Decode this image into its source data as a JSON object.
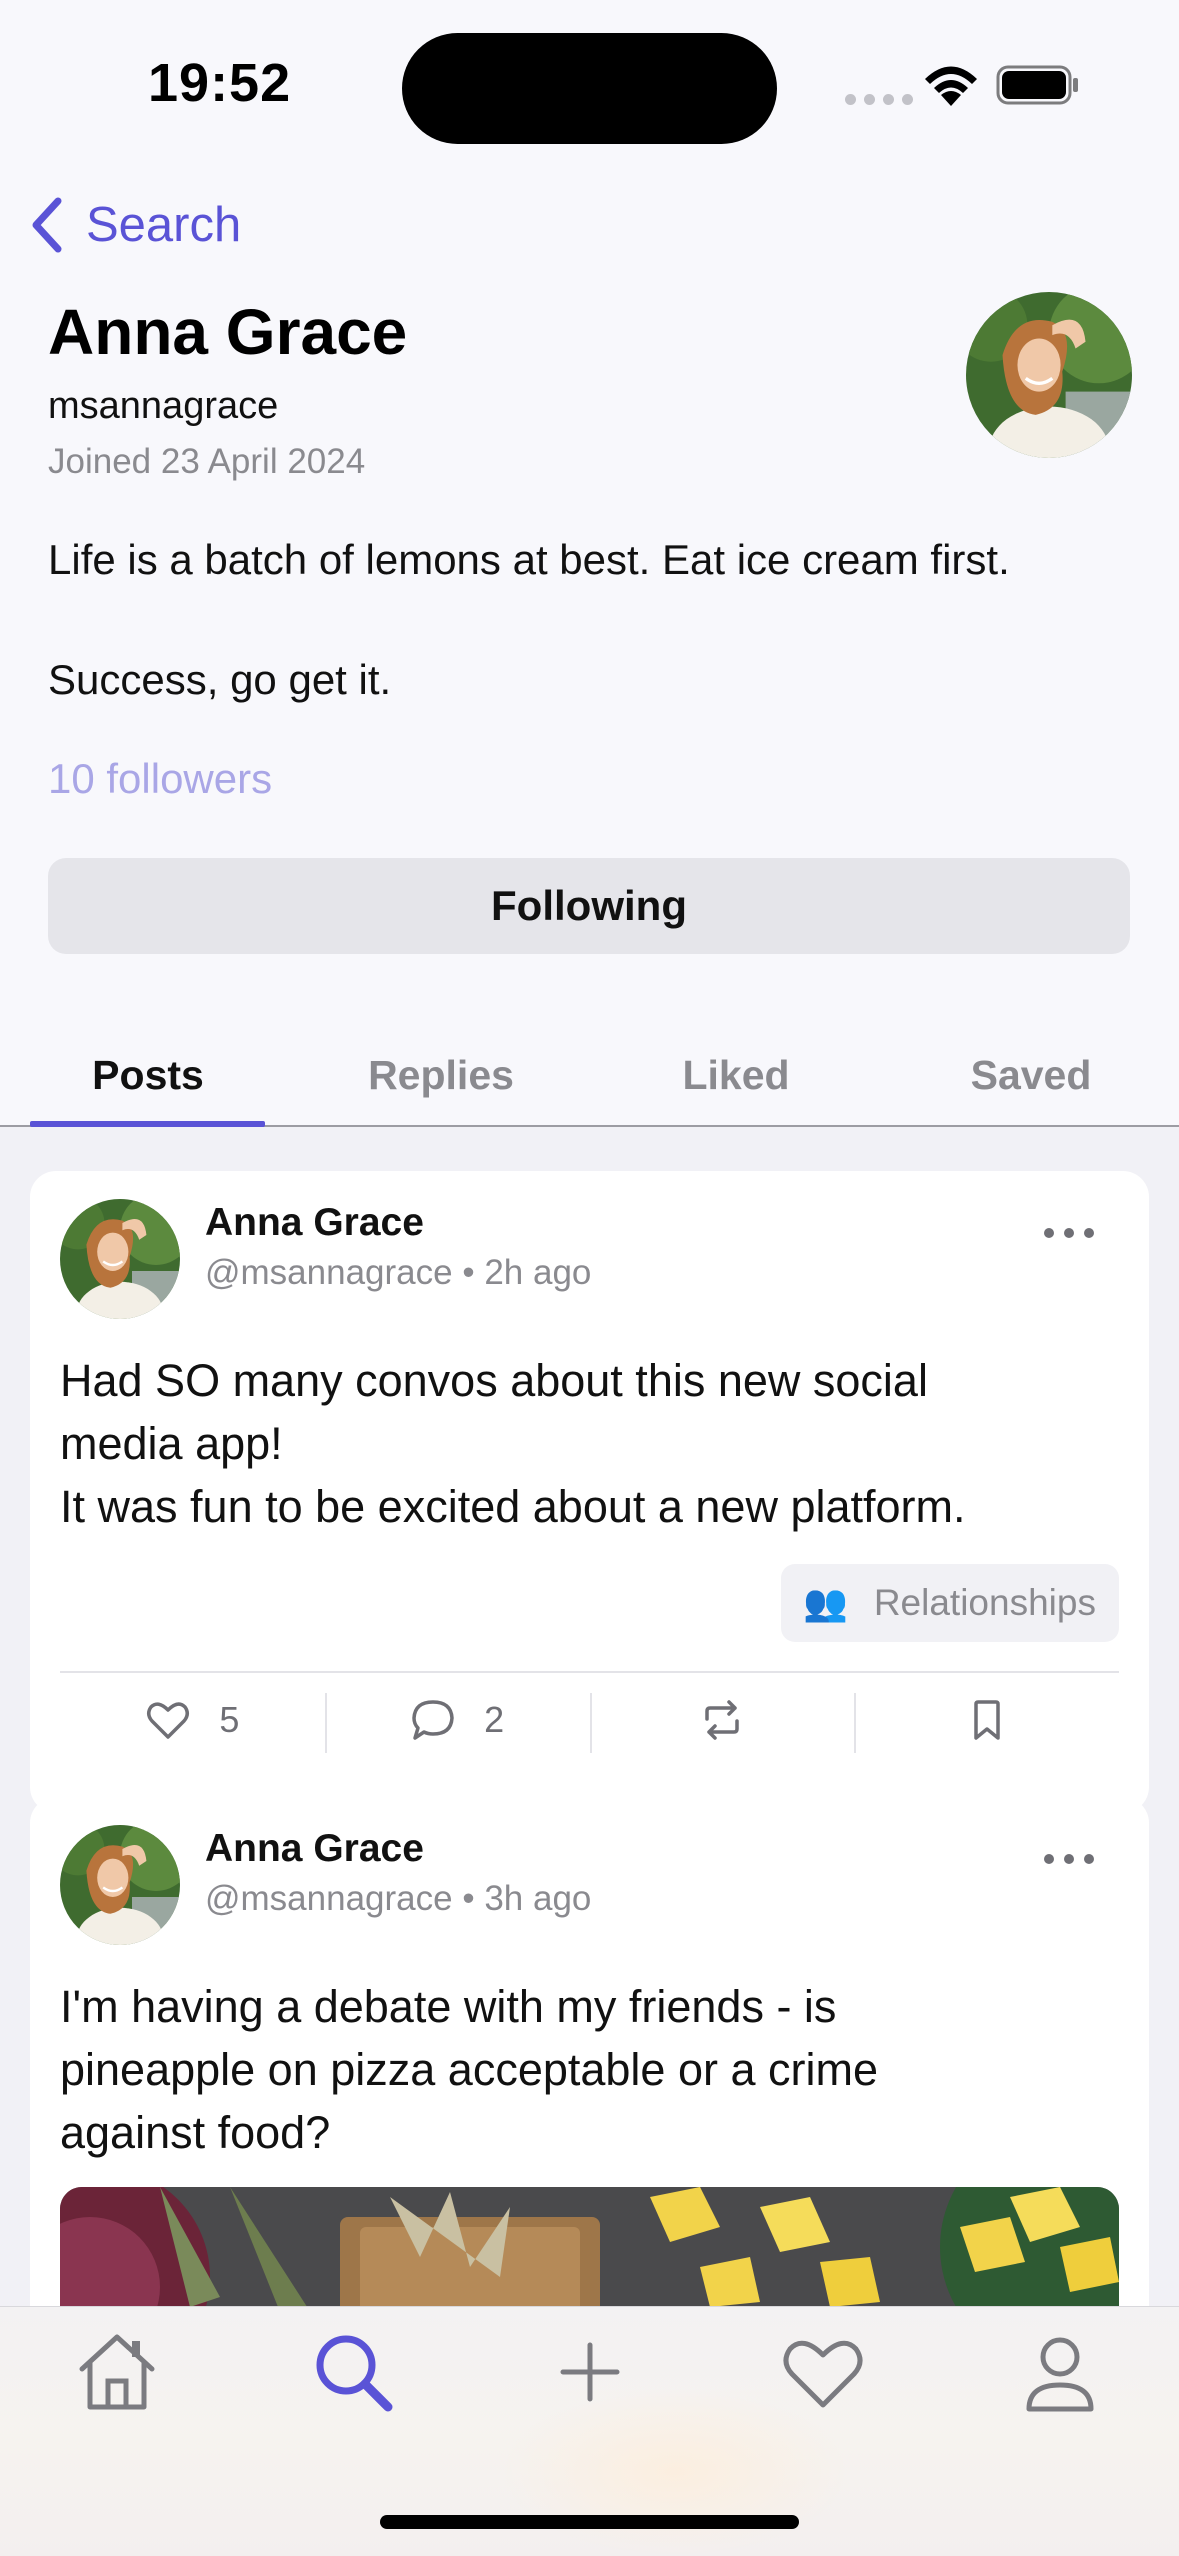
{
  "status_bar": {
    "time": "19:52"
  },
  "nav": {
    "back_label": "Search"
  },
  "profile": {
    "name": "Anna Grace",
    "handle": "msannagrace",
    "joined": "Joined 23 April 2024",
    "bio_lines": [
      "Life is a batch of lemons at best. Eat ice cream first.",
      "Success, go get it."
    ],
    "followers": "10 followers",
    "follow_button": "Following"
  },
  "tabs": [
    {
      "label": "Posts",
      "active": true
    },
    {
      "label": "Replies",
      "active": false
    },
    {
      "label": "Liked",
      "active": false
    },
    {
      "label": "Saved",
      "active": false
    }
  ],
  "posts": [
    {
      "author": "Anna Grace",
      "handle": "@msannagrace",
      "time": "2h ago",
      "text_lines": [
        "Had SO many convos about this new social",
        "media app!",
        "It was fun to be excited about a new platform."
      ],
      "topic": {
        "icon": "people-icon",
        "label": "Relationships"
      },
      "likes": "5",
      "comments": "2"
    },
    {
      "author": "Anna Grace",
      "handle": "@msannagrace",
      "time": "3h ago",
      "text_lines": [
        "I'm having a debate with my friends - is",
        "pineapple on pizza acceptable or a crime",
        "against food?"
      ]
    }
  ],
  "tab_bar": {
    "items": [
      "home-icon",
      "search-icon",
      "plus-icon",
      "heart-icon",
      "person-icon"
    ],
    "active": "search-icon"
  },
  "colors": {
    "accent": "#5a53d6",
    "followers": "#a9a6e6",
    "secondary_text": "#8a8a8f",
    "button_bg": "#e5e5ea"
  }
}
